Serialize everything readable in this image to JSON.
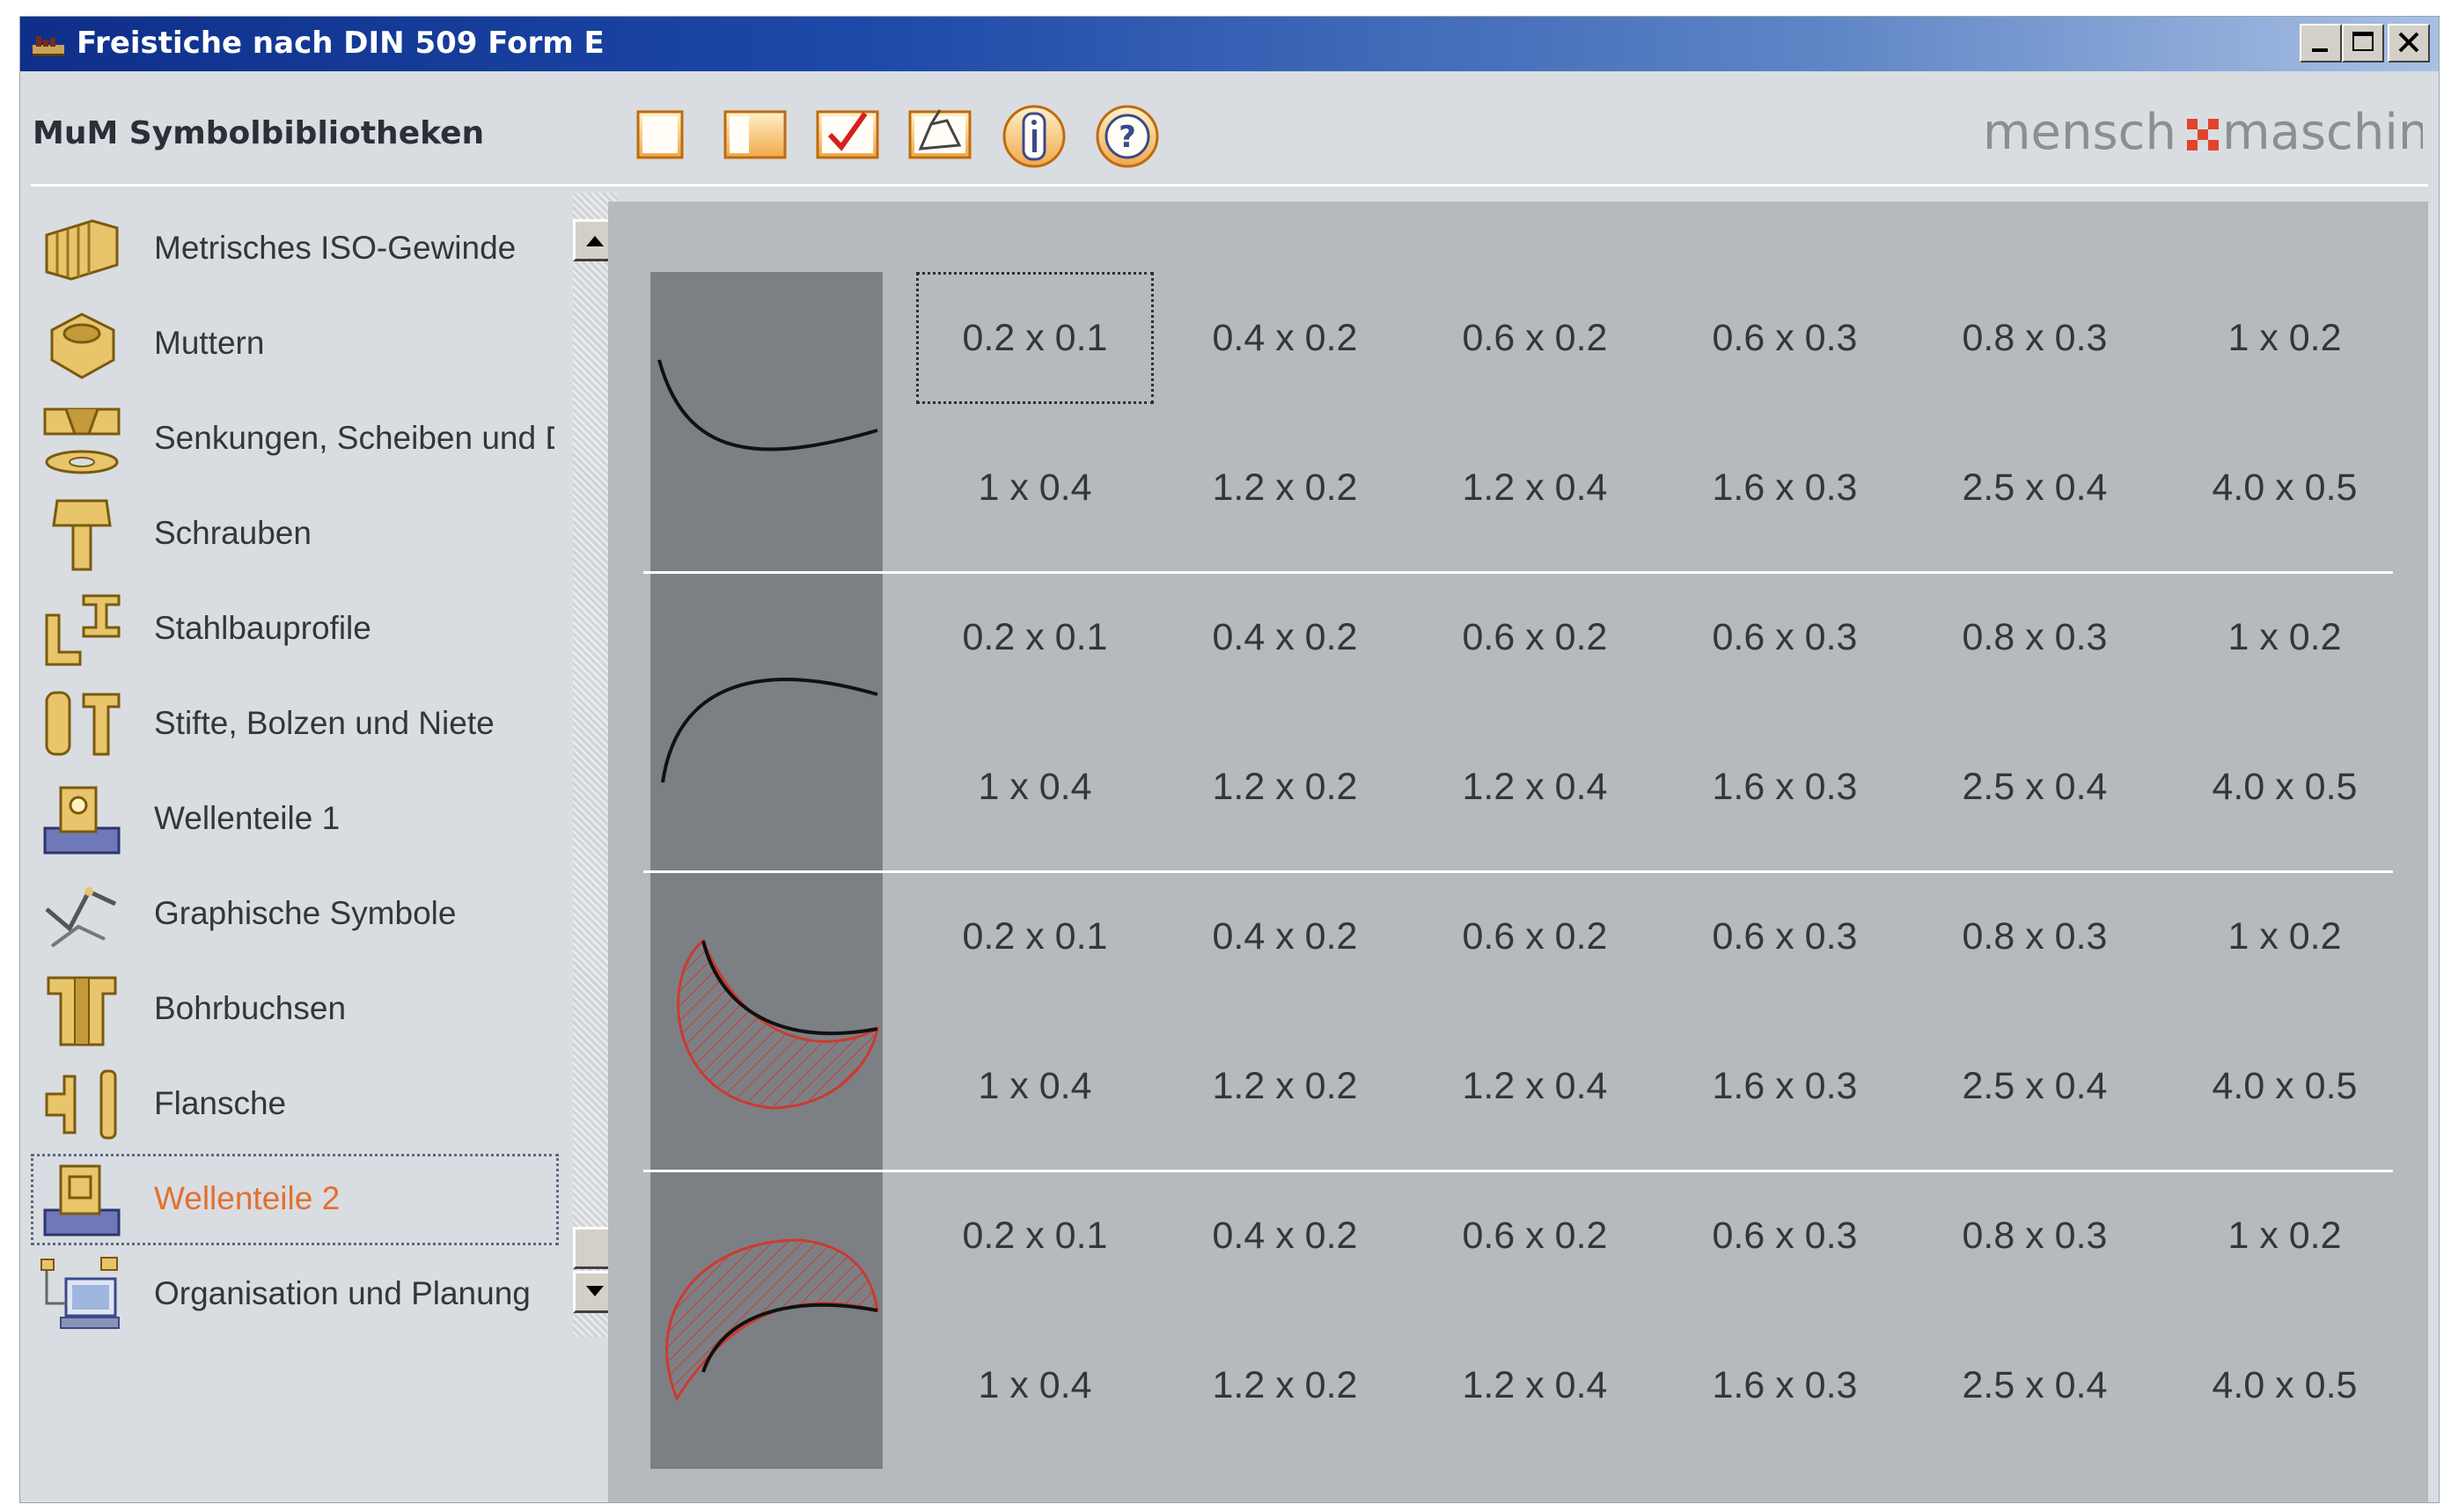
{
  "window": {
    "title": "Freistiche nach DIN 509 Form E"
  },
  "header": {
    "library_label": "MuM Symbolbibliotheken",
    "brand": "mensch maschine"
  },
  "sidebar": {
    "items": [
      {
        "label": "Metrisches ISO-Gewinde",
        "icon": "thread-icon"
      },
      {
        "label": "Muttern",
        "icon": "nut-icon"
      },
      {
        "label": "Senkungen, Scheiben und Du",
        "icon": "countersink-washer-icon"
      },
      {
        "label": "Schrauben",
        "icon": "screw-icon"
      },
      {
        "label": "Stahlbauprofile",
        "icon": "steel-profile-icon"
      },
      {
        "label": "Stifte, Bolzen und Niete",
        "icon": "pin-bolt-icon"
      },
      {
        "label": "Wellenteile 1",
        "icon": "shaft-part-icon"
      },
      {
        "label": "Graphische Symbole",
        "icon": "graphic-symbols-icon"
      },
      {
        "label": "Bohrbuchsen",
        "icon": "drill-bushing-icon"
      },
      {
        "label": "Flansche",
        "icon": "flange-icon"
      },
      {
        "label": "Wellenteile 2",
        "icon": "shaft-part-icon",
        "active": true
      },
      {
        "label": "Organisation und Planung",
        "icon": "computer-planning-icon"
      }
    ]
  },
  "grid": {
    "rows": [
      {
        "preview": "undercut-curve-down",
        "top": [
          "0.2 x 0.1",
          "0.4 x 0.2",
          "0.6 x 0.2",
          "0.6 x 0.3",
          "0.8 x 0.3",
          "1 x 0.2"
        ],
        "bottom": [
          "1 x 0.4",
          "1.2 x 0.2",
          "1.2 x 0.4",
          "1.6 x 0.3",
          "2.5 x 0.4",
          "4.0 x 0.5"
        ]
      },
      {
        "preview": "undercut-curve-up",
        "top": [
          "0.2 x 0.1",
          "0.4 x 0.2",
          "0.6 x 0.2",
          "0.6 x 0.3",
          "0.8 x 0.3",
          "1 x 0.2"
        ],
        "bottom": [
          "1 x 0.4",
          "1.2 x 0.2",
          "1.2 x 0.4",
          "1.6 x 0.3",
          "2.5 x 0.4",
          "4.0 x 0.5"
        ]
      },
      {
        "preview": "undercut-hatched-down",
        "top": [
          "0.2 x 0.1",
          "0.4 x 0.2",
          "0.6 x 0.2",
          "0.6 x 0.3",
          "0.8 x 0.3",
          "1 x 0.2"
        ],
        "bottom": [
          "1 x 0.4",
          "1.2 x 0.2",
          "1.2 x 0.4",
          "1.6 x 0.3",
          "2.5 x 0.4",
          "4.0 x 0.5"
        ]
      },
      {
        "preview": "undercut-hatched-up",
        "top": [
          "0.2 x 0.1",
          "0.4 x 0.2",
          "0.6 x 0.2",
          "0.6 x 0.3",
          "0.8 x 0.3",
          "1 x 0.2"
        ],
        "bottom": [
          "1 x 0.4",
          "1.2 x 0.2",
          "1.2 x 0.4",
          "1.6 x 0.3",
          "2.5 x 0.4",
          "4.0 x 0.5"
        ]
      }
    ]
  },
  "colors": {
    "accent": "#e3702d",
    "brand_red": "#e0452a",
    "titlebar": "#0e2f8a",
    "panel": "#b6babe"
  }
}
